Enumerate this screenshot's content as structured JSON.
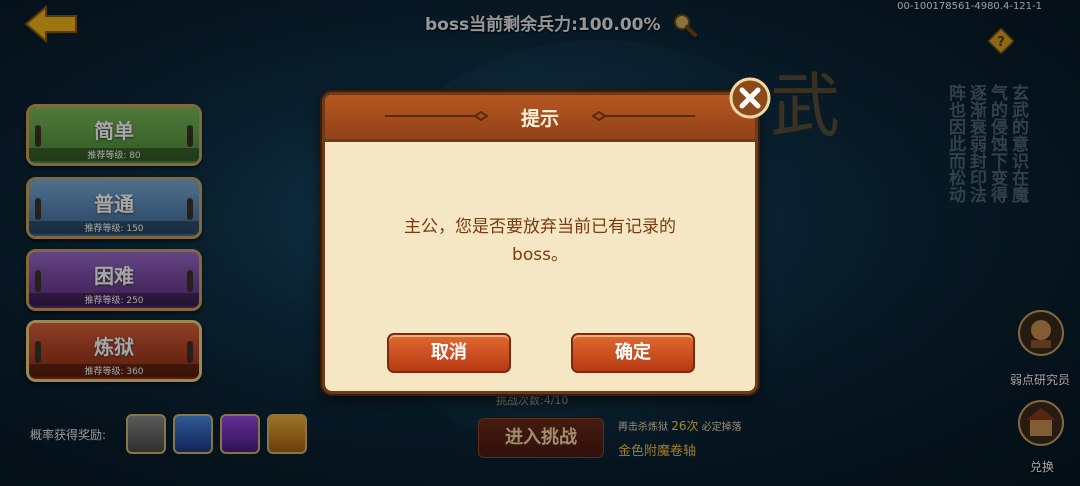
{
  "top": {
    "boss_status": "boss当前剩余兵力:100.00%",
    "build_id": "00-100178561-4980.4-121-1"
  },
  "difficulty": [
    {
      "label": "简单",
      "rec": "推荐等级: 80",
      "bg": "#5d9a4a"
    },
    {
      "label": "普通",
      "rec": "推荐等级: 150",
      "bg": "#4a7aa8"
    },
    {
      "label": "困难",
      "rec": "推荐等级: 250",
      "bg": "#6a3a8a"
    },
    {
      "label": "炼狱",
      "rec": "推荐等级: 360",
      "bg": "#a83a20"
    }
  ],
  "rewards": {
    "label": "概率获得奖励:",
    "slot_colors": [
      "#6a6a6a",
      "#2a5aa8",
      "#6a2a9a",
      "#c88a20"
    ]
  },
  "seal_text": "玄武的意识在魔气的侵蚀下变得逐渐衰弱封印法阵也因此而松动",
  "side": {
    "research_label": "弱点研究员",
    "exchange_label": "兑换"
  },
  "bottom": {
    "challenge_count": "挑战次数:4/10",
    "enter_label": "进入挑战",
    "kill_prefix": "再击杀炼狱",
    "kill_count": "26次",
    "kill_suffix": "必定掉落",
    "gold_scroll": "金色附魔卷轴"
  },
  "dialog": {
    "title": "提示",
    "message_line1": "主公，您是否要放弃当前已有记录的",
    "message_line2": "boss。",
    "cancel_label": "取消",
    "confirm_label": "确定"
  }
}
